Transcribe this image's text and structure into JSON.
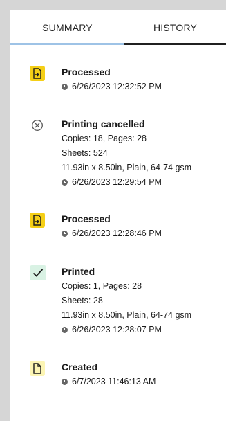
{
  "tabs": [
    {
      "label": "SUMMARY"
    },
    {
      "label": "HISTORY"
    }
  ],
  "entries": [
    {
      "title": "Processed",
      "icon": "processed-document-icon",
      "lines": [],
      "timestamp": "6/26/2023 12:32:52 PM"
    },
    {
      "title": "Printing cancelled",
      "icon": "cancel-circle-icon",
      "lines": [
        "Copies: 18, Pages: 28",
        "Sheets: 524",
        "11.93in x 8.50in, Plain, 64-74 gsm"
      ],
      "timestamp": "6/26/2023 12:29:54 PM"
    },
    {
      "title": "Processed",
      "icon": "processed-document-icon",
      "lines": [],
      "timestamp": "6/26/2023 12:28:46 PM"
    },
    {
      "title": "Printed",
      "icon": "checkmark-icon",
      "lines": [
        "Copies: 1, Pages: 28",
        "Sheets: 28",
        "11.93in x 8.50in, Plain, 64-74 gsm"
      ],
      "timestamp": "6/26/2023 12:28:07 PM"
    },
    {
      "title": "Created",
      "icon": "document-icon",
      "lines": [],
      "timestamp": "6/7/2023 11:46:13 AM"
    }
  ],
  "colors": {
    "processed_icon_bg": "#f5cf16",
    "printed_icon_bg": "#d9f2e4",
    "created_icon_bg": "#fcf5b4",
    "active_tab_underline": "#9ec3e6"
  }
}
